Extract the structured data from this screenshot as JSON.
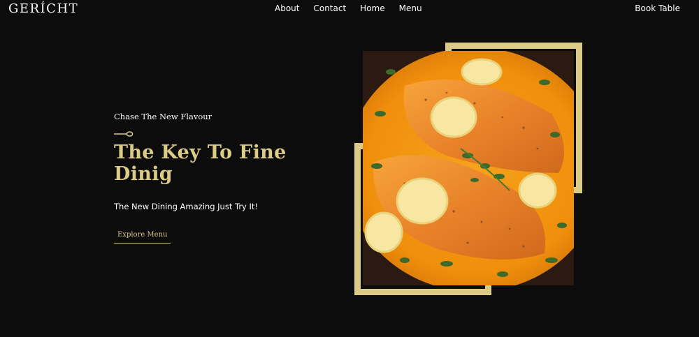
{
  "header": {
    "logo": "GERÍCHT",
    "nav": [
      "About",
      "Contact",
      "Home",
      "Menu"
    ],
    "book_table": "Book Table"
  },
  "hero": {
    "subtitle": "Chase The New Flavour",
    "title": "The Key To Fine Dinig",
    "tagline": "The New Dining Amazing Just Try It!",
    "cta": "Explore Menu",
    "spoon_icon": "spoon-icon",
    "image": "salmon-dish-image"
  },
  "colors": {
    "background": "#0c0c0c",
    "accent_gold": "#dcca87",
    "text": "#ffffff"
  }
}
